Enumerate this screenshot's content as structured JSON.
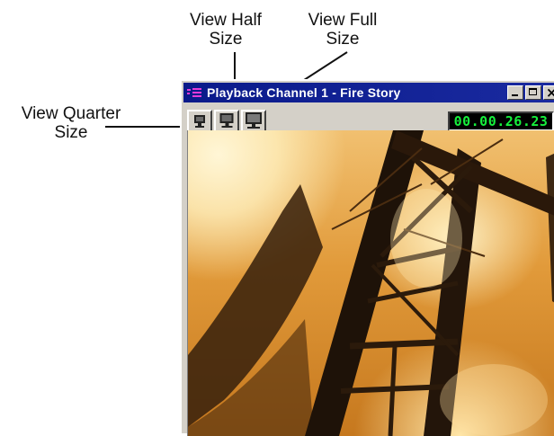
{
  "callouts": {
    "view_half": "View Half\nSize",
    "view_full": "View Full\nSize",
    "view_quarter": "View Quarter\nSize"
  },
  "window": {
    "title": "Playback Channel 1 - Fire Story",
    "timecode": "00.00.26.23",
    "accent_color": "#0a1a8a",
    "timecode_color": "#16f03c"
  },
  "toolbar": {
    "buttons": [
      {
        "name": "view-quarter-size-button",
        "icon": "monitor-small-icon"
      },
      {
        "name": "view-half-size-button",
        "icon": "monitor-medium-icon"
      },
      {
        "name": "view-full-size-button",
        "icon": "monitor-large-icon"
      }
    ]
  },
  "video": {
    "content": "fire-scene-frame"
  }
}
